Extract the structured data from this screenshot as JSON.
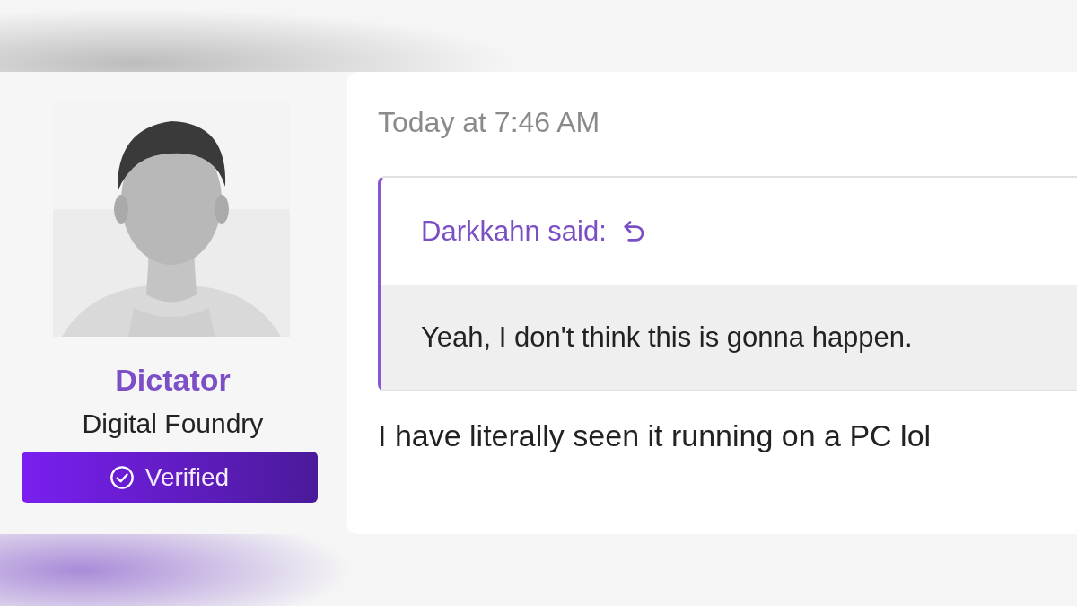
{
  "author": {
    "name": "Dictator",
    "title": "Digital Foundry",
    "badge": {
      "label": "Verified"
    }
  },
  "post": {
    "timestamp": "Today at 7:46 AM",
    "quote": {
      "author": "Darkkahn said:",
      "text": "Yeah, I don't think this is gonna happen."
    },
    "message": "I have literally seen it running on a PC lol"
  }
}
